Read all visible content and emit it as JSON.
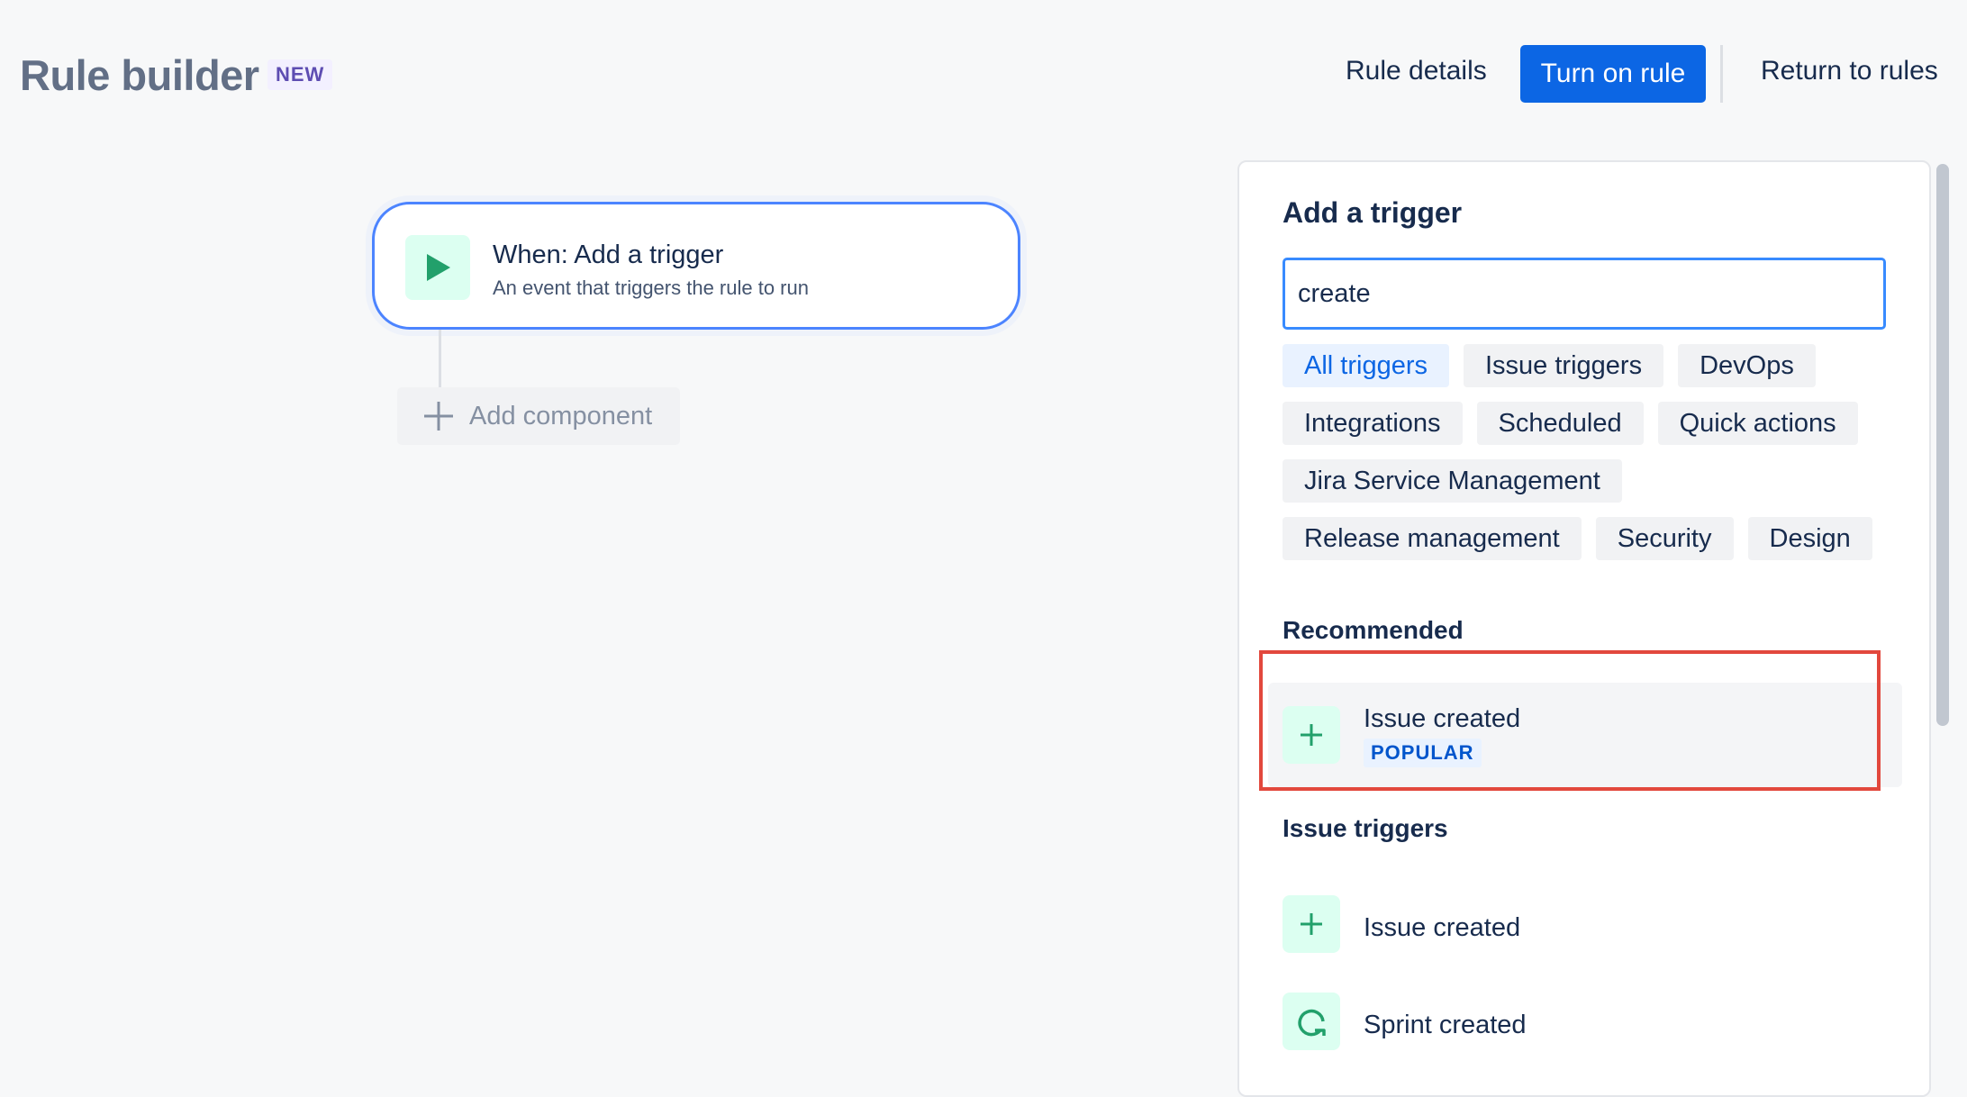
{
  "header": {
    "title": "Rule builder",
    "badge": "NEW",
    "rule_details": "Rule details",
    "turn_on": "Turn on rule",
    "return_rules": "Return to rules"
  },
  "canvas": {
    "trigger_title": "When: Add a trigger",
    "trigger_subtitle": "An event that triggers the rule to run",
    "add_component": "Add component"
  },
  "panel": {
    "title": "Add a trigger",
    "search_value": "create",
    "chips": [
      [
        "All triggers",
        "Issue triggers",
        "DevOps"
      ],
      [
        "Integrations",
        "Scheduled",
        "Quick actions"
      ],
      [
        "Jira Service Management"
      ],
      [
        "Release management",
        "Security",
        "Design"
      ]
    ],
    "active_chip": "All triggers",
    "recommended_heading": "Recommended",
    "recommended_item": {
      "label": "Issue created",
      "badge": "POPULAR",
      "icon": "plus-icon"
    },
    "issue_triggers_heading": "Issue triggers",
    "issue_triggers": [
      {
        "label": "Issue created",
        "icon": "plus-icon"
      },
      {
        "label": "Sprint created",
        "icon": "sprint-icon"
      }
    ]
  },
  "colors": {
    "primary": "#0c66e4",
    "highlight_box": "#e2483d",
    "icon_green": "#22a06b"
  }
}
